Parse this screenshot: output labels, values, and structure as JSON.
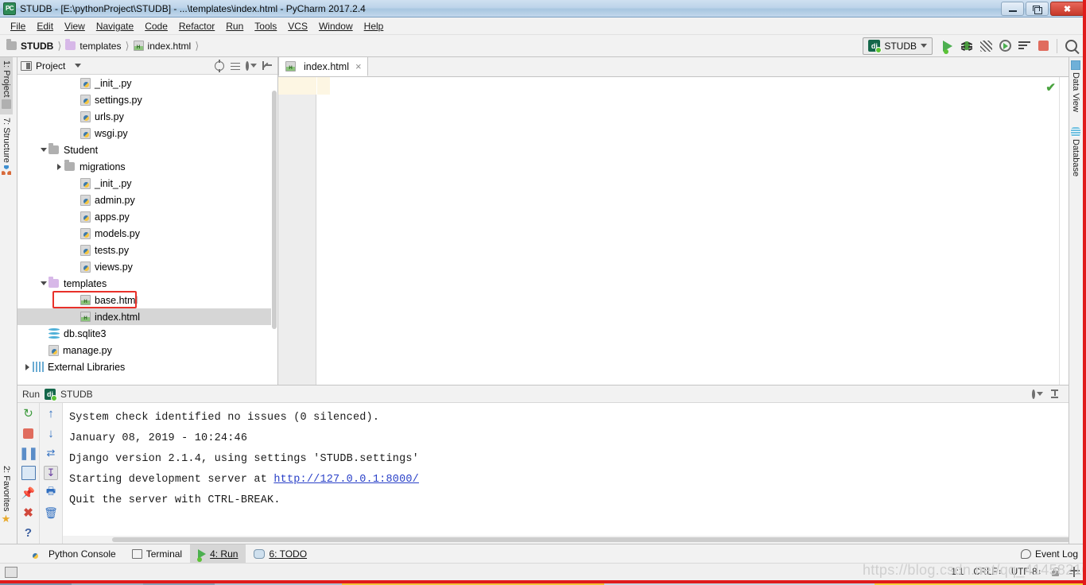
{
  "window": {
    "title": "STUDB - [E:\\pythonProject\\STUDB] - ...\\templates\\index.html - PyCharm 2017.2.4",
    "app_icon": "PC",
    "minimize": "minimize-button",
    "maximize": "restore-button",
    "close": "close-button"
  },
  "menu": [
    {
      "label": "File"
    },
    {
      "label": "Edit"
    },
    {
      "label": "View"
    },
    {
      "label": "Navigate"
    },
    {
      "label": "Code"
    },
    {
      "label": "Refactor"
    },
    {
      "label": "Run"
    },
    {
      "label": "Tools"
    },
    {
      "label": "VCS"
    },
    {
      "label": "Window"
    },
    {
      "label": "Help"
    }
  ],
  "breadcrumbs": [
    {
      "label": "STUDB",
      "icon": "folder-icon"
    },
    {
      "label": "templates",
      "icon": "folder-purple-icon"
    },
    {
      "label": "index.html",
      "icon": "html-file-icon"
    }
  ],
  "toolbar": {
    "run_config": "STUDB",
    "run_config_icon": "django-icon",
    "buttons": [
      {
        "name": "run-button",
        "title": "Run"
      },
      {
        "name": "debug-button",
        "title": "Debug"
      },
      {
        "name": "coverage-button",
        "title": "Run with Coverage"
      },
      {
        "name": "profile-button",
        "title": "Profile"
      },
      {
        "name": "run-with-console-button",
        "title": "Run"
      },
      {
        "name": "stop-button",
        "title": "Stop"
      },
      {
        "name": "search-everywhere-button",
        "title": "Search"
      }
    ]
  },
  "left_strip": [
    {
      "label": "1: Project",
      "icon": "project-icon",
      "active": true
    },
    {
      "label": "7: Structure",
      "icon": "structure-icon",
      "active": false
    },
    {
      "label": "2: Favorites",
      "icon": "star-icon",
      "active": false
    }
  ],
  "right_strip": [
    {
      "label": "Data View",
      "icon": "grid-icon"
    },
    {
      "label": "Database",
      "icon": "database-icon"
    }
  ],
  "project_panel": {
    "title": "Project",
    "actions": [
      "locate-icon",
      "collapse-all-icon",
      "settings-icon",
      "hide-icon"
    ],
    "tree": [
      {
        "label": "_init_.py",
        "icon": "python-file-icon",
        "indent": 4,
        "arrow": "none",
        "selected": false
      },
      {
        "label": "settings.py",
        "icon": "python-file-icon",
        "indent": 4,
        "arrow": "none",
        "selected": false
      },
      {
        "label": "urls.py",
        "icon": "python-file-icon",
        "indent": 4,
        "arrow": "none",
        "selected": false
      },
      {
        "label": "wsgi.py",
        "icon": "python-file-icon",
        "indent": 4,
        "arrow": "none",
        "selected": false
      },
      {
        "label": "Student",
        "icon": "folder-icon",
        "indent": 2,
        "arrow": "down",
        "selected": false
      },
      {
        "label": "migrations",
        "icon": "folder-icon",
        "indent": 3,
        "arrow": "right",
        "selected": false
      },
      {
        "label": "_init_.py",
        "icon": "python-file-icon",
        "indent": 4,
        "arrow": "none",
        "selected": false
      },
      {
        "label": "admin.py",
        "icon": "python-file-icon",
        "indent": 4,
        "arrow": "none",
        "selected": false
      },
      {
        "label": "apps.py",
        "icon": "python-file-icon",
        "indent": 4,
        "arrow": "none",
        "selected": false
      },
      {
        "label": "models.py",
        "icon": "python-file-icon",
        "indent": 4,
        "arrow": "none",
        "selected": false
      },
      {
        "label": "tests.py",
        "icon": "python-file-icon",
        "indent": 4,
        "arrow": "none",
        "selected": false
      },
      {
        "label": "views.py",
        "icon": "python-file-icon",
        "indent": 4,
        "arrow": "none",
        "selected": false
      },
      {
        "label": "templates",
        "icon": "folder-purple-icon",
        "indent": 2,
        "arrow": "down",
        "selected": false
      },
      {
        "label": "base.html",
        "icon": "html-file-icon",
        "indent": 4,
        "arrow": "none",
        "selected": false
      },
      {
        "label": "index.html",
        "icon": "html-file-icon",
        "indent": 4,
        "arrow": "none",
        "selected": true
      },
      {
        "label": "db.sqlite3",
        "icon": "database-file-icon",
        "indent": 2,
        "arrow": "none",
        "selected": false
      },
      {
        "label": "manage.py",
        "icon": "python-file-icon",
        "indent": 2,
        "arrow": "none",
        "selected": false
      },
      {
        "label": "External Libraries",
        "icon": "library-icon",
        "indent": 1,
        "arrow": "right",
        "selected": false
      }
    ]
  },
  "editor": {
    "tabs": [
      {
        "label": "index.html",
        "icon": "html-file-icon",
        "active": true,
        "close": "×"
      }
    ],
    "inspection_status": "✔",
    "content": ""
  },
  "run_panel": {
    "title": "Run",
    "config_name": "STUDB",
    "config_icon": "django-icon",
    "left_tools": [
      "rerun-icon",
      "stop-icon",
      "pause-icon",
      "console-icon",
      "pin-icon",
      "close-icon",
      "help-icon"
    ],
    "right_tools": [
      "up-arrow-icon",
      "down-arrow-icon",
      "soft-wrap-icon",
      "scroll-to-end-icon",
      "print-icon",
      "trash-icon"
    ],
    "header_actions": [
      "settings-icon",
      "hide-icon"
    ],
    "console_lines": [
      {
        "text": "System check identified no issues (0 silenced).",
        "link": null
      },
      {
        "text": "January 08, 2019 - 10:24:46",
        "link": null
      },
      {
        "text": "Django version 2.1.4, using settings 'STUDB.settings'",
        "link": null
      },
      {
        "text": "Starting development server at ",
        "link": "http://127.0.0.1:8000/"
      },
      {
        "text": "Quit the server with CTRL-BREAK.",
        "link": null
      }
    ]
  },
  "bottom_tabs": [
    {
      "label": "Python Console",
      "icon": "python-icon",
      "active": false
    },
    {
      "label": "Terminal",
      "icon": "terminal-icon",
      "active": false
    },
    {
      "label": "4: Run",
      "icon": "run-icon",
      "active": true
    },
    {
      "label": "6: TODO",
      "icon": "todo-icon",
      "active": false
    }
  ],
  "event_log": {
    "label": "Event Log",
    "icon": "balloon-icon"
  },
  "status_bar": {
    "caret_position": "1:1",
    "line_separator": "CRLF",
    "encoding": "UTF-8",
    "lock_icon": "lock-icon",
    "vcs_icon": "git-branch-icon"
  },
  "watermark": "https://blog.csdn.net/qq_41458210"
}
